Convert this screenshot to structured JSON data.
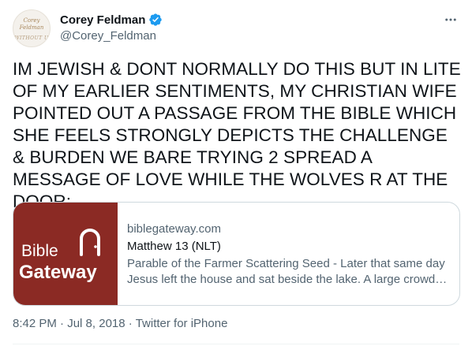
{
  "author": {
    "name": "Corey Feldman",
    "handle": "@Corey_Feldman",
    "avatar_text": [
      "Corey",
      "Feldman",
      "WITHOUT U"
    ],
    "verified": true,
    "verified_color": "#1d9bf0"
  },
  "tweet": {
    "text": "IM JEWISH & DONT NORMALLY DO THIS BUT IN LITE OF MY EARLIER SENTIMENTS, MY CHRISTIAN WIFE POINTED OUT A PASSAGE FROM THE BIBLE WHICH SHE FEELS STRONGLY DEPICTS THE CHALLENGE & BURDEN WE BARE TRYING 2 SPREAD A MESSAGE OF LOVE WHILE THE WOLVES R AT THE DOOR:"
  },
  "link_card": {
    "domain": "biblegateway.com",
    "title": "Matthew 13 (NLT)",
    "description": "Parable of the Farmer Scattering Seed - Later that same day Jesus left the house and sat beside the lake. A large crowd soon gathered around him",
    "logo_line1": "Bible",
    "logo_line2": "Gateway",
    "logo_bg": "#8b2a24"
  },
  "meta": {
    "time": "8:42 PM",
    "date": "Jul 8, 2018",
    "separator": "·",
    "source": "Twitter for iPhone"
  },
  "icons": {
    "more": "more-icon",
    "verified": "verified-badge-icon"
  }
}
